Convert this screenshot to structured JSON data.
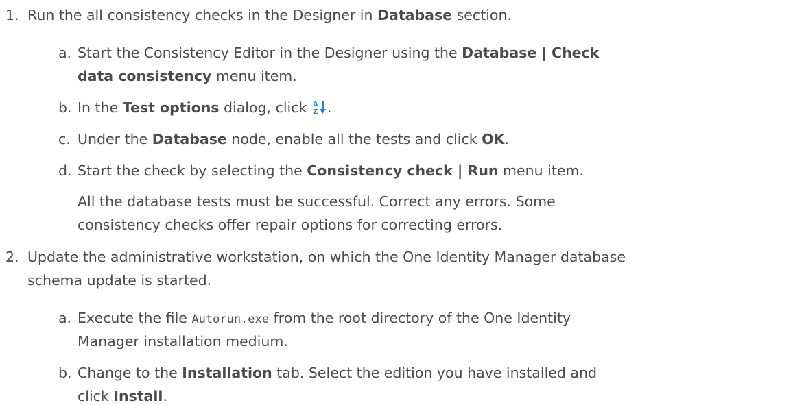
{
  "steps": [
    {
      "number": "1.",
      "text_before": "Run the all consistency checks in the Designer in ",
      "bold": "Database",
      "text_after": " section.",
      "substeps": [
        {
          "letter": "a.",
          "line1_before": "Start the Consistency Editor in the Designer using the ",
          "line1_bold": "Database | Check",
          "line2_bold": "data consistency",
          "line2_after": " menu item."
        },
        {
          "letter": "b.",
          "before": "In the ",
          "bold": "Test options",
          "after": " dialog, click ",
          "icon": "sort-az-icon",
          "end": "."
        },
        {
          "letter": "c.",
          "before": "Under the ",
          "bold": "Database",
          "middle": " node, enable all the tests and click ",
          "bold2": "OK",
          "end": "."
        },
        {
          "letter": "d.",
          "before": "Start the check by selecting the ",
          "bold": "Consistency check | Run",
          "after": " menu item.",
          "note_line1": "All the database tests must be successful. Correct any errors. Some",
          "note_line2": "consistency checks offer repair options for correcting errors."
        }
      ]
    },
    {
      "number": "2.",
      "line1": "Update the administrative workstation, on which the One Identity Manager database",
      "line2": "schema update is started.",
      "substeps": [
        {
          "letter": "a.",
          "line1_before": "Execute the file ",
          "line1_code": "Autorun.exe",
          "line1_after": " from the root directory of the One Identity",
          "line2": "Manager installation medium."
        },
        {
          "letter": "b.",
          "line1_before": "Change to the ",
          "line1_bold": "Installation",
          "line1_after": " tab. Select the edition you have installed and",
          "line2_before": "click ",
          "line2_bold": "Install",
          "line2_after": "."
        }
      ]
    }
  ],
  "colors": {
    "text": "#494b4f",
    "icon_blue": "#2a7fc9",
    "icon_cyan": "#29a9d6"
  }
}
